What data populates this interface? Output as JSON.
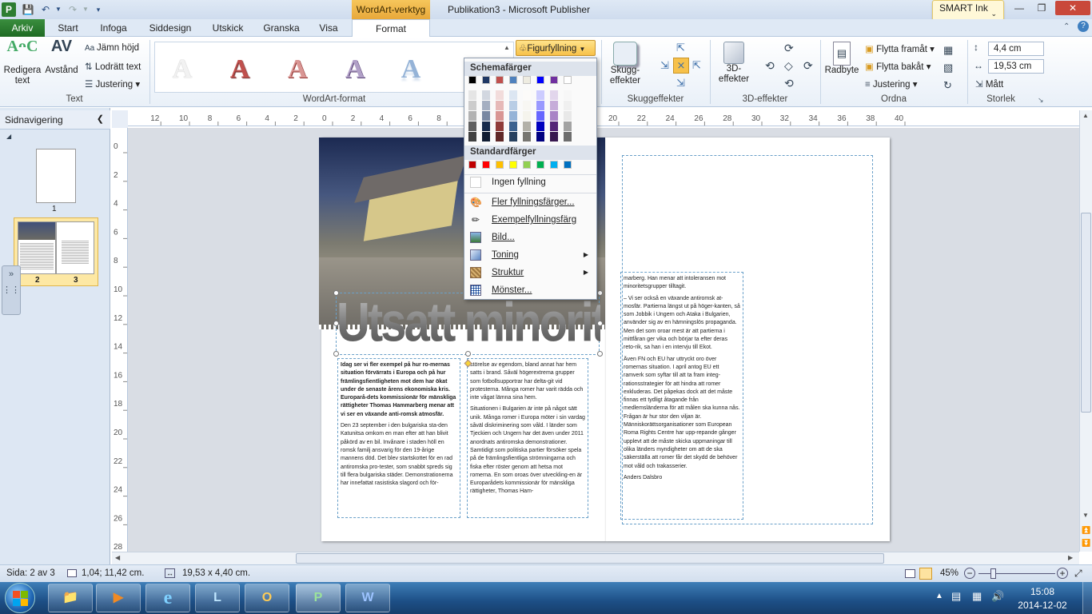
{
  "window": {
    "title": "Publikation3 - Microsoft Publisher",
    "contextual_group": "WordArt-verktyg",
    "smart_ink": "SMART Ink"
  },
  "tabs": [
    "Arkiv",
    "Start",
    "Infoga",
    "Siddesign",
    "Utskick",
    "Granska",
    "Visa",
    "Format"
  ],
  "ribbon": {
    "text_group": {
      "label": "Text",
      "edit_text": "Redigera text",
      "spacing": "Avstånd",
      "even_height": "Jämn höjd",
      "vertical_text": "Lodrätt text",
      "alignment": "Justering"
    },
    "wordart_group": {
      "label": "WordArt-format"
    },
    "fill_button": "Figurfyllning",
    "shadow_group": {
      "label": "Skuggeffekter",
      "button": "Skugg-effekter"
    },
    "threed_group": {
      "label": "3D-effekter",
      "button": "3D-effekter"
    },
    "arrange_group": {
      "label": "Ordna",
      "wrap_text": "Radbyte",
      "bring_forward": "Flytta framåt",
      "send_backward": "Flytta bakåt",
      "align": "Justering"
    },
    "size_group": {
      "label": "Storlek",
      "height": "4,4 cm",
      "width": "19,53 cm",
      "measure": "Mått"
    }
  },
  "dropdown": {
    "scheme_header": "Schemafärger",
    "standard_header": "Standardfärger",
    "scheme_top": [
      "#000000",
      "#1f3864",
      "#c0504d",
      "#4f81bd",
      "#eeece1",
      "#0000ff",
      "#7030a0",
      "#ffffff"
    ],
    "standard": [
      "#c00000",
      "#ff0000",
      "#ffc000",
      "#ffff00",
      "#92d050",
      "#00b050",
      "#00b0f0",
      "#0070c0"
    ],
    "items": [
      {
        "label": "Ingen fyllning",
        "icon": "no-fill-icon"
      },
      {
        "label": "Fler fyllningsfärger...",
        "icon": "palette-icon"
      },
      {
        "label": "Exempelfyllningsfärg",
        "icon": "eyedropper-icon"
      },
      {
        "label": "Bild...",
        "icon": "picture-icon"
      },
      {
        "label": "Toning",
        "icon": "gradient-icon"
      },
      {
        "label": "Struktur",
        "icon": "texture-icon"
      },
      {
        "label": "Mönster...",
        "icon": "pattern-icon"
      }
    ]
  },
  "nav": {
    "title": "Sidnavigering",
    "page1": "1",
    "page2": "2",
    "page3": "3"
  },
  "document": {
    "wordart": "Utsatt minoritet",
    "col1_bold": "Idag ser vi fler exempel på hur ro-mernas situation förvärrats i Europa och på hur främlingsfientligheten mot dem har ökat under de senaste årens ekonomiska kris. Europarå-dets kommissionär för mänskliga rättigheter Thomas Hammarberg menar att vi ser en växande anti-romsk atmosfär.",
    "col1": "Den 23 september i den bulgariska sta-den Katunitsa omkom en man efter att han blivit påkörd av en bil. Invånare i staden höll en romsk familj ansvarig för den 19-årige mannens död. Det blev startskottet för en rad antiromska pro-tester, som snabbt spreds sig till flera bulgariska städer. Demonstrationerna har innefattat rasistiska slagord och för-",
    "col2": "störelse av egendom, bland annat har hem satts i brand. Såväl högerextrema grupper som fotbollsupportrar har delta-git vid protesterna. Många romer har varit rädda och inte vågat lämna sina hem.",
    "col2b": "Situationen i Bulgarien är inte på något sätt unik. Många romer i Europa möter i sin vardag såväl diskriminering som våld. I länder som Tjeckien och Ungern har det även under 2011 anordnats antiromska demonstrationer. Samtidigt som politiska partier försöker spela på de främlingsfientliga strömningarna och fiska efter röster genom att hetsa mot romerna. En som oroas över utveckling-en är Europarådets kommissionär för mänskliga rättigheter, Thomas Ham-",
    "col3": "marberg. Han menar att intoleransen mot minoritetsgrupper tilltagit.",
    "col3b": "– Vi ser också en växande antiromsk at-mosfär. Partierna längst ut på höger-kanten, så som Jobbik i Ungern och Ataka i Bulgarien, använder sig av en hämningslös propaganda. Men det som oroar mest är att partierna i mittfåran ger vika och börjar ta efter deras reto-rik, sa han i en intervju till Ekot.",
    "col3c": "Även FN och EU har uttryckt oro över romernas situation. I april antog EU ett ramverk som syftar till att ta fram integ-rationsstrategier för att hindra att romer exkluderas. Det påpekas dock att det måste finnas ett tydligt åtagande från medlemsländerna för att målen ska kunna nås. Frågan är hur stor den viljan är. Människorättsorganisationer som European Roma Rights Centre har upp-repande gånger upplevt att de måste skicka uppmaningar till olika länders myndigheter om att de ska säkerställa att romer får det skydd de behöver mot våld och trakasserier.",
    "author": "Anders Dalsbro"
  },
  "status": {
    "page": "Sida: 2 av 3",
    "position": "1,04; 11,42 cm.",
    "size": "19,53 x  4,40 cm.",
    "zoom": "45%"
  },
  "taskbar": {
    "time": "15:08",
    "date": "2014-12-02"
  }
}
